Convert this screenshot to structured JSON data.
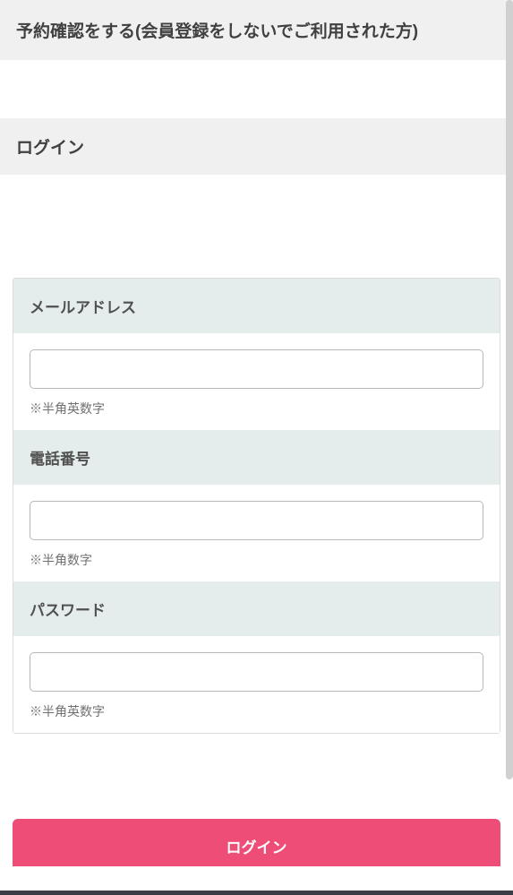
{
  "header": {
    "title": "予約確認をする(会員登録をしないでご利用された方)"
  },
  "login": {
    "section_title": "ログイン",
    "fields": {
      "email": {
        "label": "メールアドレス",
        "hint": "※半角英数字",
        "value": ""
      },
      "phone": {
        "label": "電話番号",
        "hint": "※半角数字",
        "value": ""
      },
      "password": {
        "label": "パスワード",
        "hint": "※半角英数字",
        "value": ""
      }
    },
    "button_label": "ログイン"
  }
}
